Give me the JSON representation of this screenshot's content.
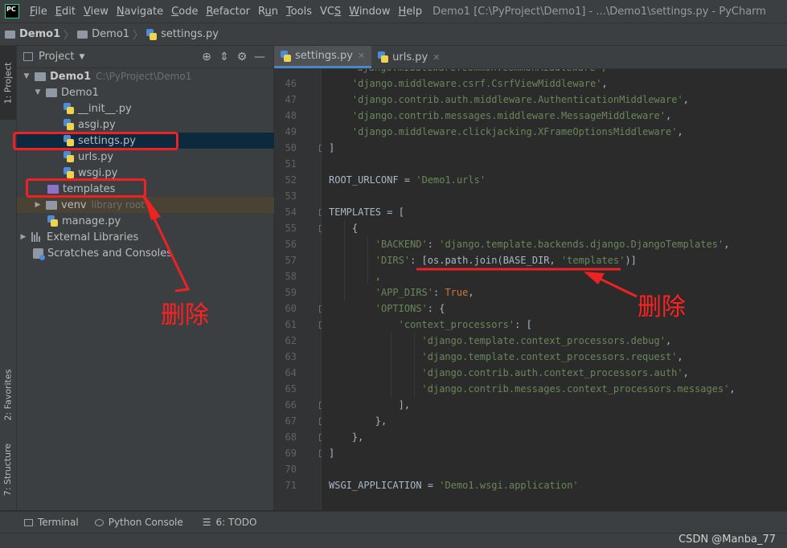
{
  "app": {
    "logo_text": "PC",
    "window_title": "Demo1 [C:\\PyProject\\Demo1] - ...\\Demo1\\settings.py - PyCharm"
  },
  "menu": [
    {
      "name": "file",
      "pre": "",
      "mn": "F",
      "post": "ile"
    },
    {
      "name": "edit",
      "pre": "",
      "mn": "E",
      "post": "dit"
    },
    {
      "name": "view",
      "pre": "",
      "mn": "V",
      "post": "iew"
    },
    {
      "name": "navigate",
      "pre": "",
      "mn": "N",
      "post": "avigate"
    },
    {
      "name": "code",
      "pre": "",
      "mn": "C",
      "post": "ode"
    },
    {
      "name": "refactor",
      "pre": "",
      "mn": "R",
      "post": "efactor"
    },
    {
      "name": "run",
      "pre": "R",
      "mn": "u",
      "post": "n"
    },
    {
      "name": "tools",
      "pre": "",
      "mn": "T",
      "post": "ools"
    },
    {
      "name": "vcs",
      "pre": "VC",
      "mn": "S",
      "post": ""
    },
    {
      "name": "window",
      "pre": "",
      "mn": "W",
      "post": "indow"
    },
    {
      "name": "help",
      "pre": "",
      "mn": "H",
      "post": "elp"
    }
  ],
  "breadcrumb": {
    "root": "Demo1",
    "folder": "Demo1",
    "file": "settings.py"
  },
  "side_tabs": {
    "project": "1: Project",
    "favorites": "2: Favorites",
    "structure": "7: Structure"
  },
  "project_panel": {
    "title": "Project",
    "tree": {
      "root": "Demo1",
      "root_path": "C:\\PyProject\\Demo1",
      "pkg": "Demo1",
      "init": "__init__.py",
      "asgi": "asgi.py",
      "settings": "settings.py",
      "urls": "urls.py",
      "wsgi": "wsgi.py",
      "templates": "templates",
      "venv": "venv",
      "venv_note": "library root",
      "manage": "manage.py",
      "ext_libs": "External Libraries",
      "scratches": "Scratches and Consoles"
    }
  },
  "editor": {
    "tabs": [
      {
        "label": "settings.py",
        "active": true
      },
      {
        "label": "urls.py",
        "active": false
      }
    ],
    "lines": [
      {
        "n": "46",
        "d": 2,
        "t": [
          [
            "s",
            "'django.middleware.csrf.CsrfViewMiddleware'"
          ],
          [
            "p",
            ","
          ]
        ]
      },
      {
        "n": "47",
        "d": 2,
        "t": [
          [
            "s",
            "'django.contrib.auth.middleware.AuthenticationMiddleware'"
          ],
          [
            "p",
            ","
          ]
        ]
      },
      {
        "n": "48",
        "d": 2,
        "t": [
          [
            "s",
            "'django.contrib.messages.middleware.MessageMiddleware'"
          ],
          [
            "p",
            ","
          ]
        ]
      },
      {
        "n": "49",
        "d": 2,
        "t": [
          [
            "s",
            "'django.middleware.clickjacking.XFrameOptionsMiddleware'"
          ],
          [
            "p",
            ","
          ]
        ]
      },
      {
        "n": "50",
        "d": 0,
        "t": [
          [
            "p",
            "]"
          ]
        ]
      },
      {
        "n": "51",
        "d": 0,
        "t": []
      },
      {
        "n": "52",
        "d": 0,
        "t": [
          [
            "p",
            "ROOT_URLCONF = "
          ],
          [
            "s",
            "'Demo1.urls'"
          ]
        ]
      },
      {
        "n": "53",
        "d": 0,
        "t": []
      },
      {
        "n": "54",
        "d": 0,
        "t": [
          [
            "p",
            "TEMPLATES = ["
          ]
        ]
      },
      {
        "n": "55",
        "d": 2,
        "t": [
          [
            "p",
            "{"
          ]
        ]
      },
      {
        "n": "56",
        "d": 4,
        "t": [
          [
            "s",
            "'BACKEND'"
          ],
          [
            "p",
            ": "
          ],
          [
            "s",
            "'django.template.backends.django.DjangoTemplates'"
          ],
          [
            "p",
            ","
          ]
        ]
      },
      {
        "n": "57",
        "d": 4,
        "t": [
          [
            "s",
            "'DIRS'"
          ],
          [
            "p",
            ": [os.path.join(BASE_DIR, "
          ],
          [
            "s",
            "'templates'"
          ],
          [
            "p",
            ")]"
          ]
        ]
      },
      {
        "n": "58",
        "d": 4,
        "t": [
          [
            "k",
            ","
          ]
        ]
      },
      {
        "n": "59",
        "d": 4,
        "t": [
          [
            "s",
            "'APP_DIRS'"
          ],
          [
            "p",
            ": "
          ],
          [
            "k",
            "True"
          ],
          [
            "p",
            ","
          ]
        ]
      },
      {
        "n": "60",
        "d": 4,
        "t": [
          [
            "s",
            "'OPTIONS'"
          ],
          [
            "p",
            ": {"
          ]
        ]
      },
      {
        "n": "61",
        "d": 6,
        "t": [
          [
            "s",
            "'context_processors'"
          ],
          [
            "p",
            ": ["
          ]
        ]
      },
      {
        "n": "62",
        "d": 8,
        "t": [
          [
            "s",
            "'django.template.context_processors.debug'"
          ],
          [
            "p",
            ","
          ]
        ]
      },
      {
        "n": "63",
        "d": 8,
        "t": [
          [
            "s",
            "'django.template.context_processors.request'"
          ],
          [
            "p",
            ","
          ]
        ]
      },
      {
        "n": "64",
        "d": 8,
        "t": [
          [
            "s",
            "'django.contrib.auth.context_processors.auth'"
          ],
          [
            "p",
            ","
          ]
        ]
      },
      {
        "n": "65",
        "d": 8,
        "t": [
          [
            "s",
            "'django.contrib.messages.context_processors.messages'"
          ],
          [
            "p",
            ","
          ]
        ]
      },
      {
        "n": "66",
        "d": 6,
        "t": [
          [
            "p",
            "],"
          ]
        ]
      },
      {
        "n": "67",
        "d": 4,
        "t": [
          [
            "p",
            "},"
          ]
        ]
      },
      {
        "n": "68",
        "d": 2,
        "t": [
          [
            "p",
            "},"
          ]
        ]
      },
      {
        "n": "69",
        "d": 0,
        "t": [
          [
            "p",
            "]"
          ]
        ]
      },
      {
        "n": "70",
        "d": 0,
        "t": []
      },
      {
        "n": "71",
        "d": 0,
        "t": [
          [
            "p",
            "WSGI_APPLICATION = "
          ],
          [
            "s",
            "'Demo1.wsgi.application'"
          ]
        ]
      }
    ],
    "top_partial": "'django.middleware.common.CommonMiddleware',"
  },
  "bottom_tabs": [
    {
      "name": "terminal",
      "label": "Terminal"
    },
    {
      "name": "python-console",
      "label": "Python Console"
    },
    {
      "name": "todo",
      "label": "6: TODO"
    }
  ],
  "annotations": {
    "left_label": "删除",
    "right_label": "删除"
  },
  "watermark": "CSDN @Manba_77",
  "colors": {
    "annotation_red": "#ee2222",
    "string_green": "#6a8759",
    "keyword_orange": "#cc7832",
    "selection_blue": "#0d293e"
  }
}
